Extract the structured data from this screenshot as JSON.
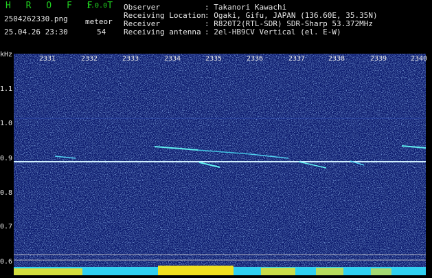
{
  "header": {
    "logo": "H R O F F T",
    "version": "1.0.0",
    "filename": "2504262330.png",
    "meteor_label": "meteor",
    "datetime": "25.04.26 23:30",
    "meteor_count": "54"
  },
  "info": [
    {
      "key": "Observer",
      "value": ": Takanori Kawachi"
    },
    {
      "key": "Receiving Location",
      "value": ": Ogaki, Gifu, JAPAN (136.60E, 35.35N)"
    },
    {
      "key": "Receiver",
      "value": ": R820T2(RTL-SDR) SDR-Sharp 53.372MHz"
    },
    {
      "key": "Receiving antenna",
      "value": ": 2el-HB9CV Vertical (el. E-W)"
    }
  ],
  "axis": {
    "y_unit": "kHz",
    "y_ticks": [
      "1.1",
      "1.0",
      "0.9",
      "0.8",
      "0.7",
      "0.6"
    ],
    "x_ticks": [
      "2331",
      "2332",
      "2333",
      "2334",
      "2335",
      "2336",
      "2337",
      "2338",
      "2339",
      "2340"
    ]
  },
  "colors": {
    "background": "#0a1a70",
    "carrier": "#d0f0ff",
    "meteor": "#60f0f0",
    "signal_bar": "#30d0f0",
    "signal_peak": "#f0e020"
  }
}
